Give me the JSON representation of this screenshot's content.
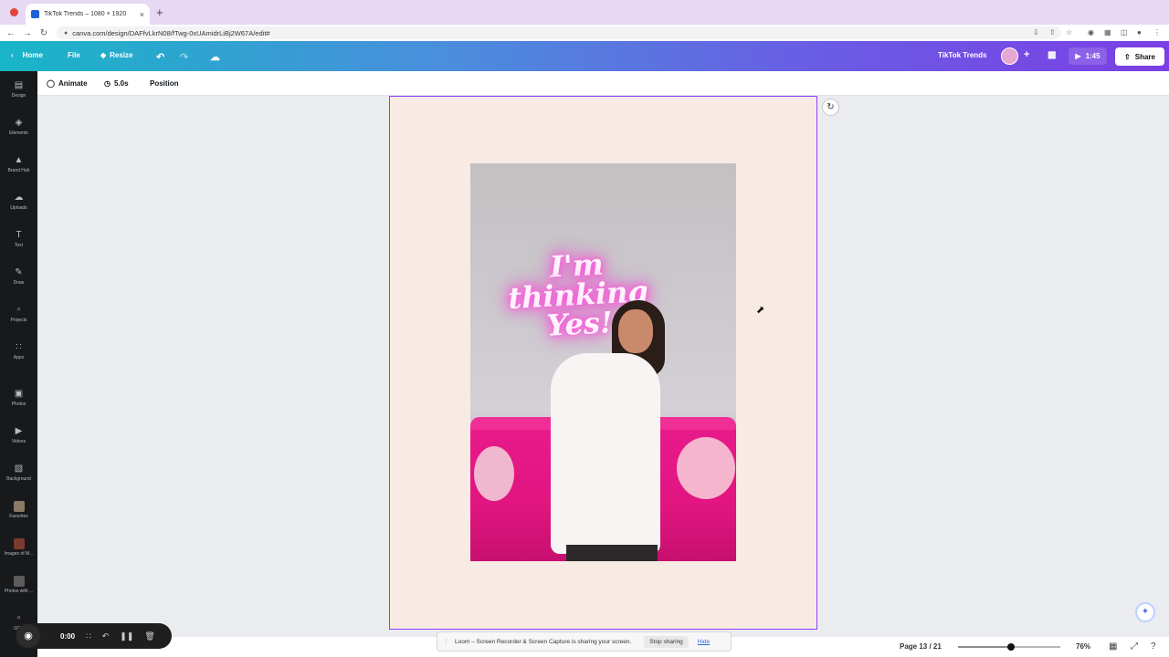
{
  "browser": {
    "tab_title": "TikTok Trends – 1080 × 1920",
    "tab_close": "×",
    "new_tab": "+",
    "url": "canva.com/design/DAFfvLkrN08/fTwg-0xUAmidrLiBj2W67A/edit#"
  },
  "topbar": {
    "home_label": "Home",
    "file_label": "File",
    "resize_label": "Resize",
    "design_title": "TikTok Trends",
    "play_time": "1:45",
    "share_label": "Share"
  },
  "context_toolbar": {
    "animate_label": "Animate",
    "duration_label": "5.0s",
    "position_label": "Position"
  },
  "sidebar": {
    "items": [
      {
        "label": "Design",
        "icon": "design-icon"
      },
      {
        "label": "Elements",
        "icon": "elements-icon"
      },
      {
        "label": "Brand Hub",
        "icon": "brand-hub-icon"
      },
      {
        "label": "Uploads",
        "icon": "uploads-icon"
      },
      {
        "label": "Text",
        "icon": "text-icon"
      },
      {
        "label": "Draw",
        "icon": "draw-icon"
      },
      {
        "label": "Projects",
        "icon": "projects-icon"
      },
      {
        "label": "Apps",
        "icon": "apps-icon"
      },
      {
        "label": "Photos",
        "icon": "photos-icon"
      },
      {
        "label": "Videos",
        "icon": "videos-icon"
      },
      {
        "label": "Background",
        "icon": "background-icon"
      },
      {
        "label": "Favorites",
        "icon": "favorites-icon"
      },
      {
        "label": "Images of M...",
        "icon": "folder-thumbnail-icon"
      },
      {
        "label": "Photos with ...",
        "icon": "folder-thumbnail-icon"
      },
      {
        "label": "GIFs",
        "icon": "gifs-icon"
      }
    ]
  },
  "canvas": {
    "neon_sign_text": "I'm thinking Yes!",
    "page_background": "#f8ebe4",
    "selection_color": "#8b3dff"
  },
  "bottombar": {
    "page_indicator": "Page 13 / 21",
    "zoom_level": "76%",
    "zoom_fraction": 0.52
  },
  "recorder": {
    "time": "0:00"
  },
  "loom_banner": {
    "message": "Loom – Screen Recorder & Screen Capture is sharing your screen.",
    "stop_label": "Stop sharing",
    "hide_label": "Hide"
  },
  "colors": {
    "brand_gradient_start": "#18b5c7",
    "brand_gradient_end": "#7b3fe4",
    "sidebar_bg": "#18191b",
    "workspace_bg": "#ebecf0"
  }
}
